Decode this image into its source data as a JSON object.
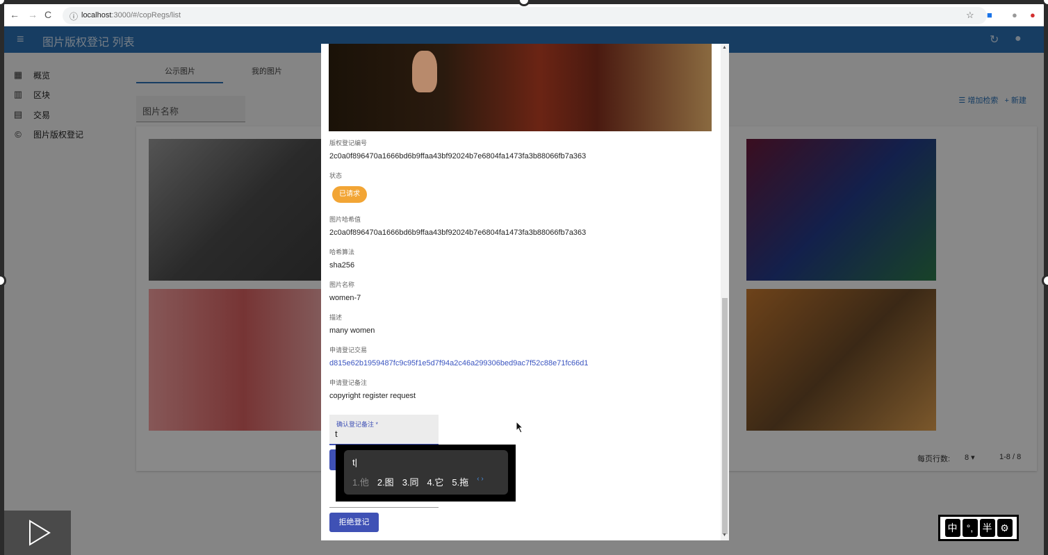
{
  "browser": {
    "url_host": "localhost",
    "url_rest": ":3000/#/copRegs/list"
  },
  "appbar": {
    "title": "图片版权登记 列表"
  },
  "sidebar": {
    "items": [
      {
        "label": "概览"
      },
      {
        "label": "区块"
      },
      {
        "label": "交易"
      },
      {
        "label": "图片版权登记"
      }
    ]
  },
  "tabs": [
    {
      "label": "公示图片"
    },
    {
      "label": "我的图片"
    }
  ],
  "filter": {
    "placeholder": "图片名称"
  },
  "actions": {
    "add_filter": "增加检索",
    "create": "新建"
  },
  "pager": {
    "rows_label": "每页行数:",
    "rows_value": "8",
    "range": "1-8 / 8"
  },
  "dialog": {
    "fields": [
      {
        "label": "版权登记编号",
        "value": "2c0a0f896470a1666bd6b9ffaa43bf92024b7e6804fa1473fa3b88066fb7a363"
      },
      {
        "label": "状态"
      },
      {
        "label": "图片哈希值",
        "value": "2c0a0f896470a1666bd6b9ffaa43bf92024b7e6804fa1473fa3b88066fb7a363"
      },
      {
        "label": "哈希算法",
        "value": "sha256"
      },
      {
        "label": "图片名称",
        "value": "women-7"
      },
      {
        "label": "描述",
        "value": "many women"
      },
      {
        "label": "申请登记交易",
        "value": "d815e62b1959487fc9c95f1e5d7f94a2c46a299306bed9ac7f52c88e71fc66d1"
      },
      {
        "label": "申请登记备注",
        "value": "copyright register request"
      }
    ],
    "status_chip": "已请求",
    "confirm_note_label": "确认登记备注 *",
    "confirm_note_value": "t",
    "reject_button": "拒绝登记"
  },
  "ime": {
    "composition": "t|",
    "candidates": [
      "1.他",
      "2.图",
      "3.同",
      "4.它",
      "5.拖"
    ]
  },
  "ime_toolbar": [
    "中",
    "°,",
    "半",
    "⚙"
  ]
}
